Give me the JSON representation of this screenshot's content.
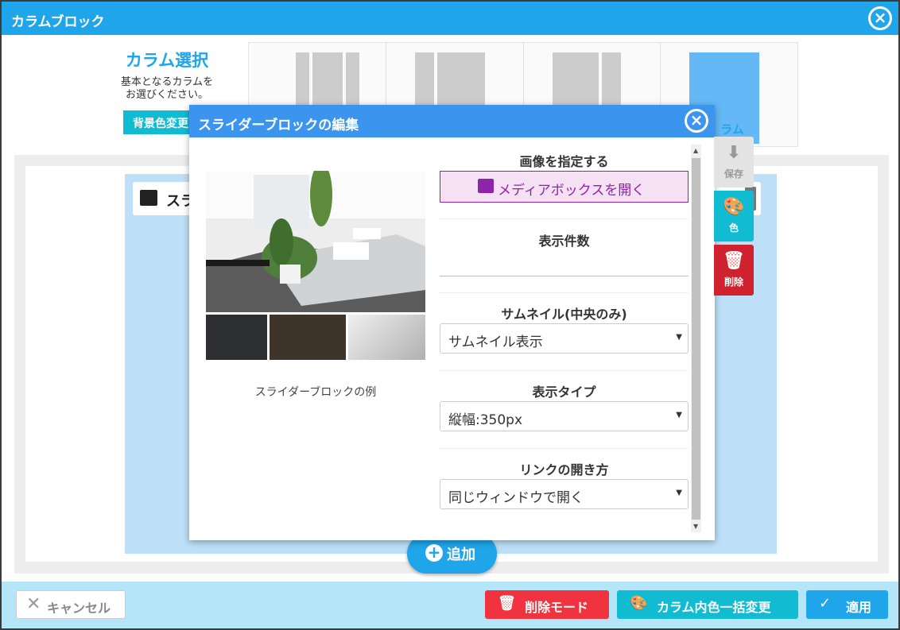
{
  "window": {
    "title": "カラムブロック",
    "close_icon": "close-icon"
  },
  "column_select": {
    "heading": "カラム選択",
    "description_line1": "基本となるカラムを",
    "description_line2": "お選びください。",
    "bg_change_label": "背景色変更",
    "option_label_partial": "ラム"
  },
  "block": {
    "label": "スラ"
  },
  "add_button": {
    "label": "追加"
  },
  "modal": {
    "title": "スライダーブロックの編集",
    "preview_caption": "スライダーブロックの例",
    "image_section": {
      "label": "画像を指定する",
      "button": "メディアボックスを開く"
    },
    "count_section": {
      "label": "表示件数",
      "value": ""
    },
    "thumbnail_section": {
      "label": "サムネイル(中央のみ)",
      "selected": "サムネイル表示"
    },
    "display_type_section": {
      "label": "表示タイプ",
      "selected": "縦幅:350px"
    },
    "link_section": {
      "label": "リンクの開き方",
      "selected": "同じウィンドウで開く"
    }
  },
  "side_tools": {
    "save": "保存",
    "color": "色",
    "delete": "削除"
  },
  "footer": {
    "cancel": "キャンセル",
    "delete_mode": "削除モード",
    "color_all": "カラム内色一括変更",
    "apply": "適用"
  },
  "colors": {
    "primary": "#1fa5ea",
    "modal_header": "#3b95ef",
    "teal": "#11bcd2",
    "danger": "#f0333f",
    "media": "#8e24aa"
  }
}
